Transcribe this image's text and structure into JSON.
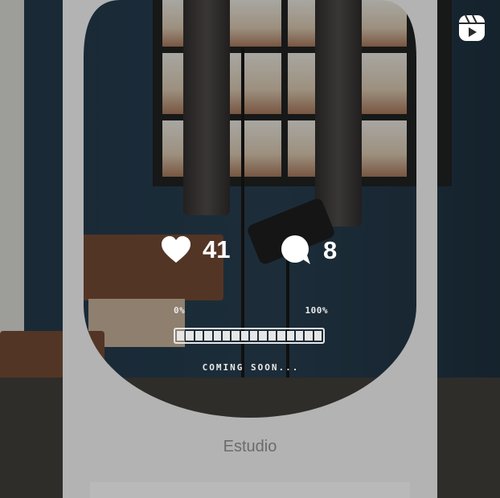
{
  "post": {
    "likes": "41",
    "comments": "8",
    "reels_icon": "reels-icon"
  },
  "progress": {
    "start_label": "0%",
    "end_label": "100%",
    "status_text": "COMING SOON...",
    "fill_fraction": 1.0
  },
  "caption": "Estudio",
  "colors": {
    "frame": "#b3b3b3",
    "overlay_text": "#ffffff",
    "caption_text": "#6b6b6b"
  }
}
